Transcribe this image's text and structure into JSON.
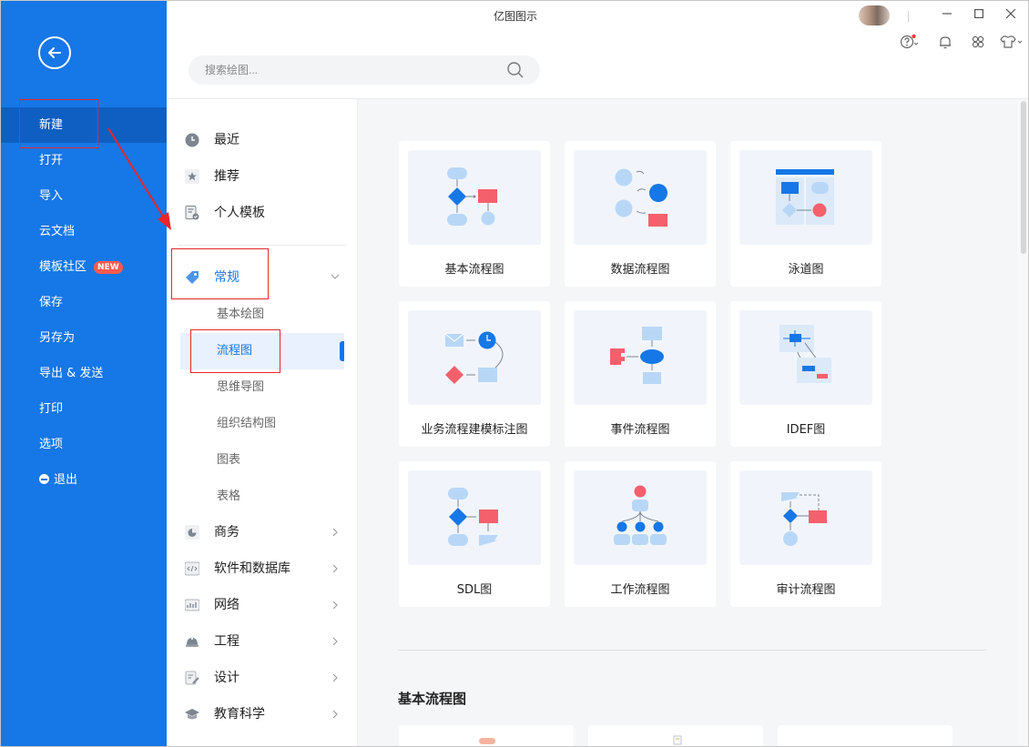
{
  "app": {
    "title": "亿图图示"
  },
  "search": {
    "placeholder": "搜索绘图..."
  },
  "sidebar": {
    "items": [
      {
        "label": "新建"
      },
      {
        "label": "打开"
      },
      {
        "label": "导入"
      },
      {
        "label": "云文档"
      },
      {
        "label": "模板社区",
        "badge": "NEW"
      },
      {
        "label": "保存"
      },
      {
        "label": "另存为"
      },
      {
        "label": "导出 & 发送"
      },
      {
        "label": "打印"
      },
      {
        "label": "选项"
      },
      {
        "label": "退出"
      }
    ]
  },
  "categories": {
    "top": [
      {
        "label": "最近"
      },
      {
        "label": "推荐"
      },
      {
        "label": "个人模板"
      }
    ],
    "general": {
      "label": "常规",
      "subs": [
        {
          "label": "基本绘图"
        },
        {
          "label": "流程图"
        },
        {
          "label": "思维导图"
        },
        {
          "label": "组织结构图"
        },
        {
          "label": "图表"
        },
        {
          "label": "表格"
        }
      ]
    },
    "others": [
      {
        "label": "商务"
      },
      {
        "label": "软件和数据库"
      },
      {
        "label": "网络"
      },
      {
        "label": "工程"
      },
      {
        "label": "设计"
      },
      {
        "label": "教育科学"
      }
    ]
  },
  "templates": [
    {
      "label": "基本流程图"
    },
    {
      "label": "数据流程图"
    },
    {
      "label": "泳道图"
    },
    {
      "label": "业务流程建模标注图"
    },
    {
      "label": "事件流程图"
    },
    {
      "label": "IDEF图"
    },
    {
      "label": "SDL图"
    },
    {
      "label": "工作流程图"
    },
    {
      "label": "审计流程图"
    }
  ],
  "section": {
    "title": "基本流程图"
  },
  "colors": {
    "sidebar": "#1677e6",
    "accent": "#1677e6",
    "shape_red": "#f4606c",
    "shape_light_blue": "#b8d7f7",
    "annotation": "#e8262b"
  }
}
